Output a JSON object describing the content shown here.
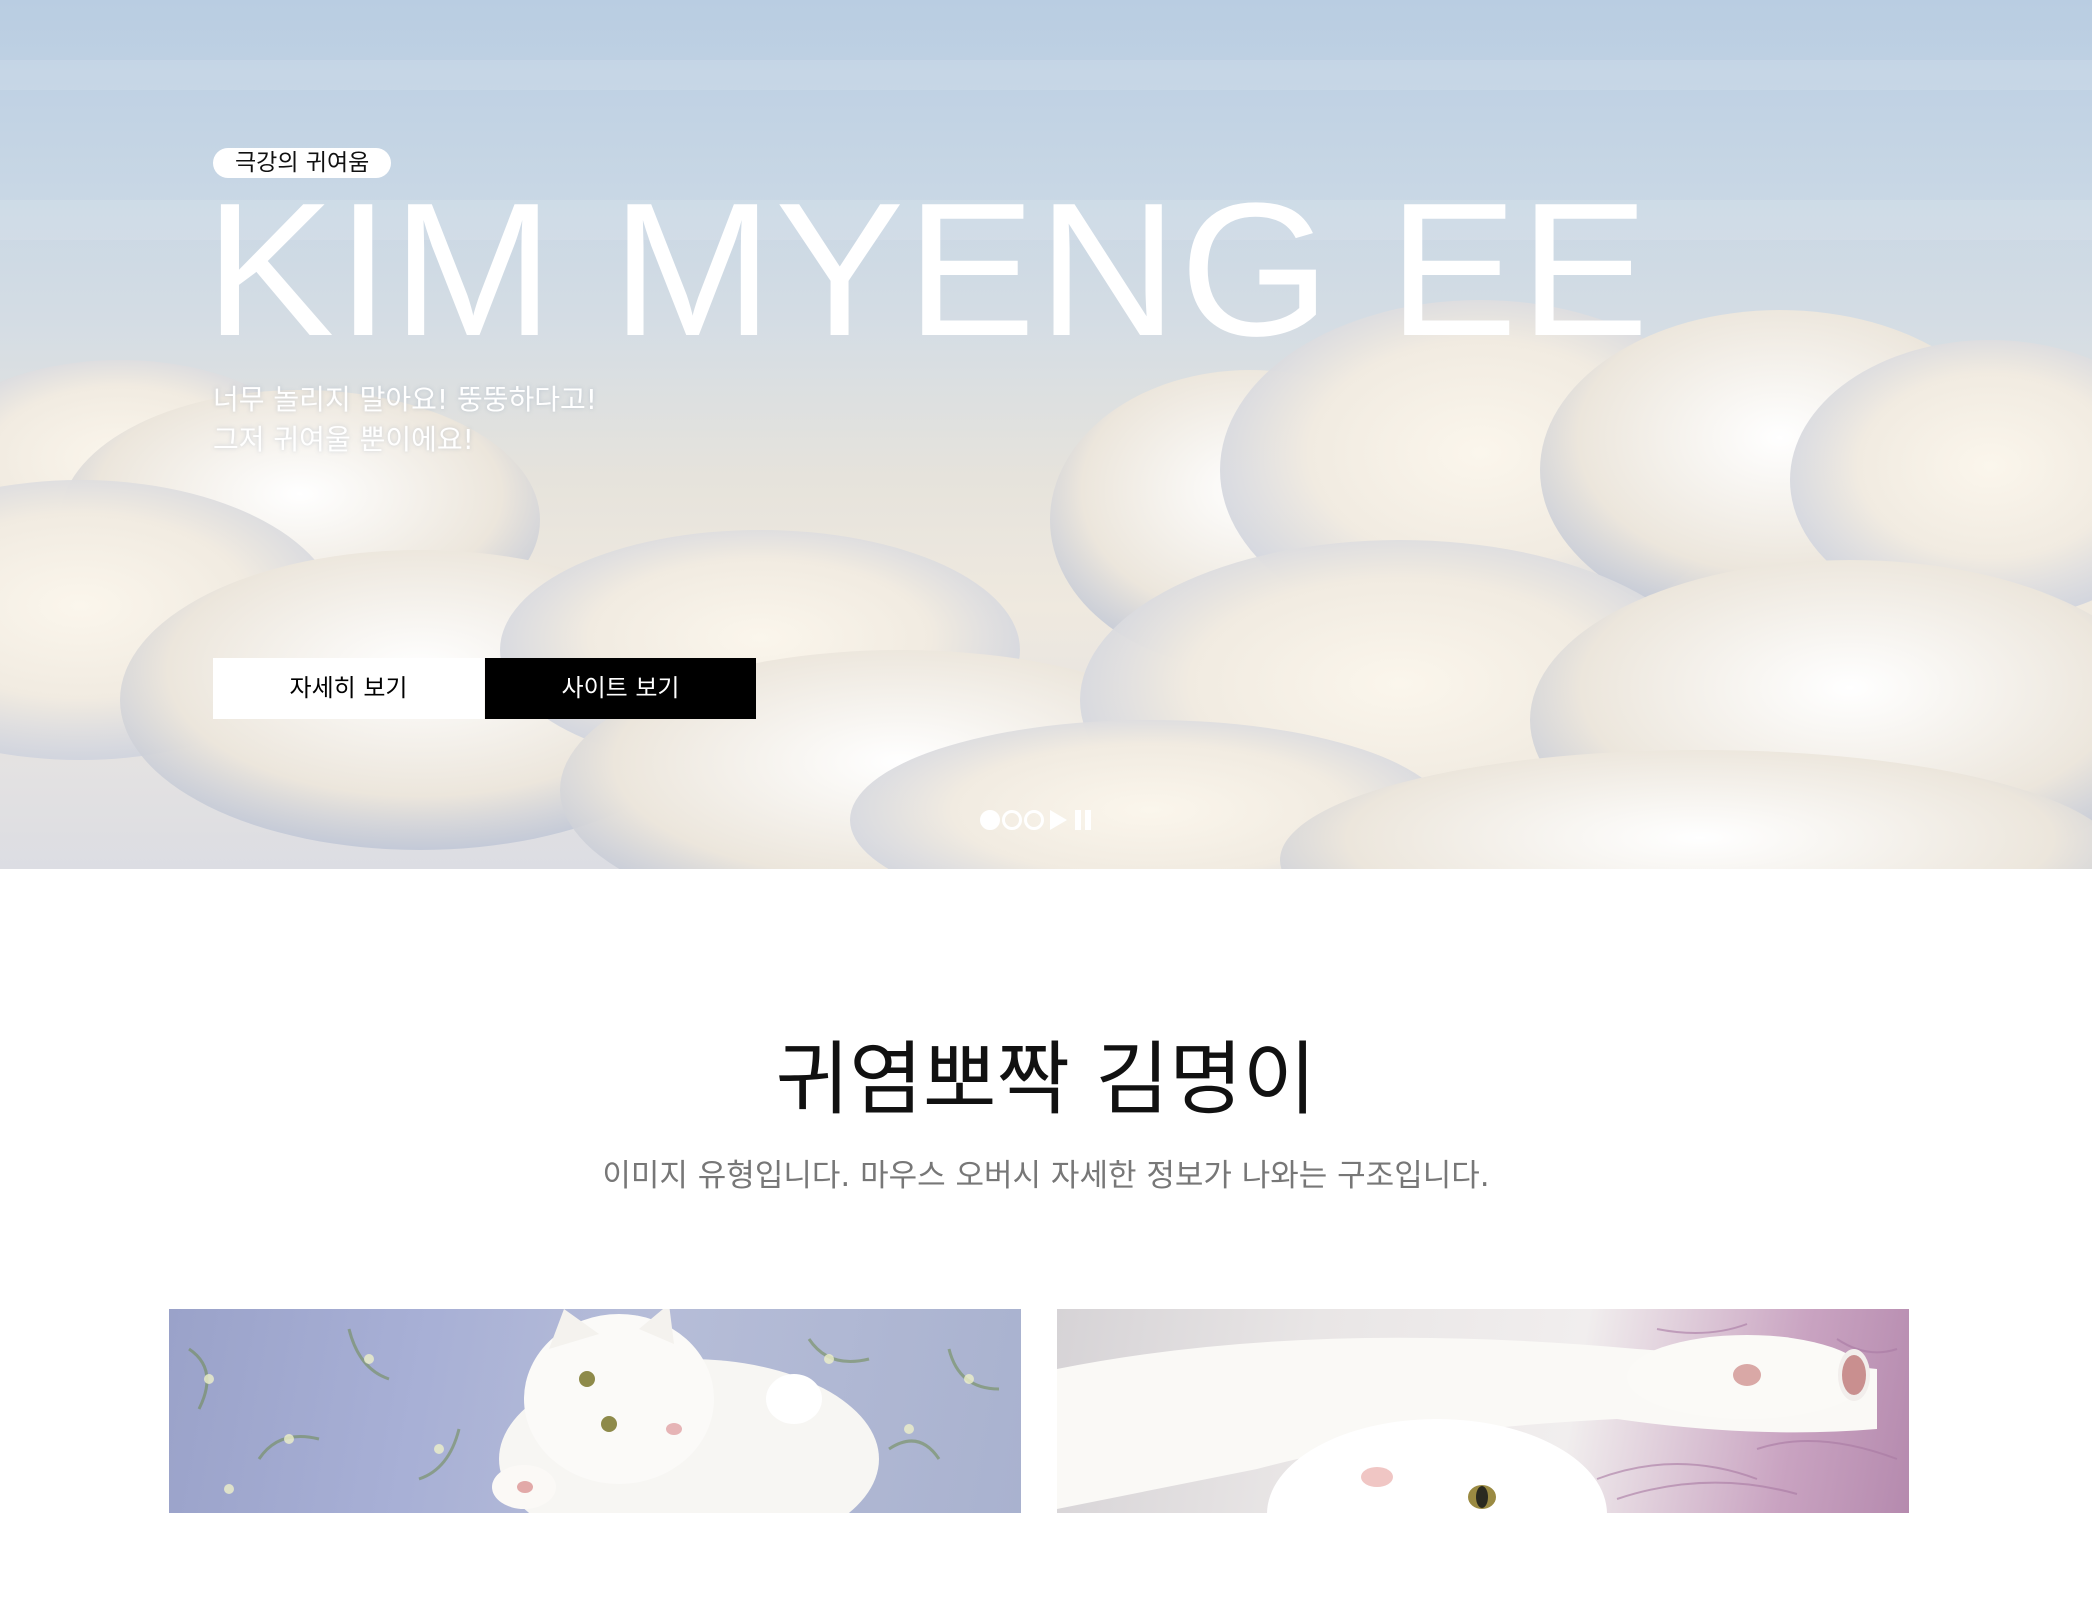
{
  "hero": {
    "badge": "극강의 귀여움",
    "title": "KIM MYENG EE",
    "desc_line1": "너무 놀리지 말아요! 뚱뚱하다고!",
    "desc_line2": "그저 귀여울 뿐이에요!",
    "btn_detail": "자세히 보기",
    "btn_site": "사이트 보기",
    "slider": {
      "total_slides": 3,
      "active_slide": 1
    }
  },
  "section": {
    "title": "귀염뽀짝 김명이",
    "desc": "이미지 유형입니다. 마우스 오버시 자세한 정보가 나와는 구조입니다."
  },
  "colors": {
    "button_dark": "#000000",
    "button_light": "#ffffff",
    "title_text": "#111111",
    "desc_text": "#777777"
  }
}
